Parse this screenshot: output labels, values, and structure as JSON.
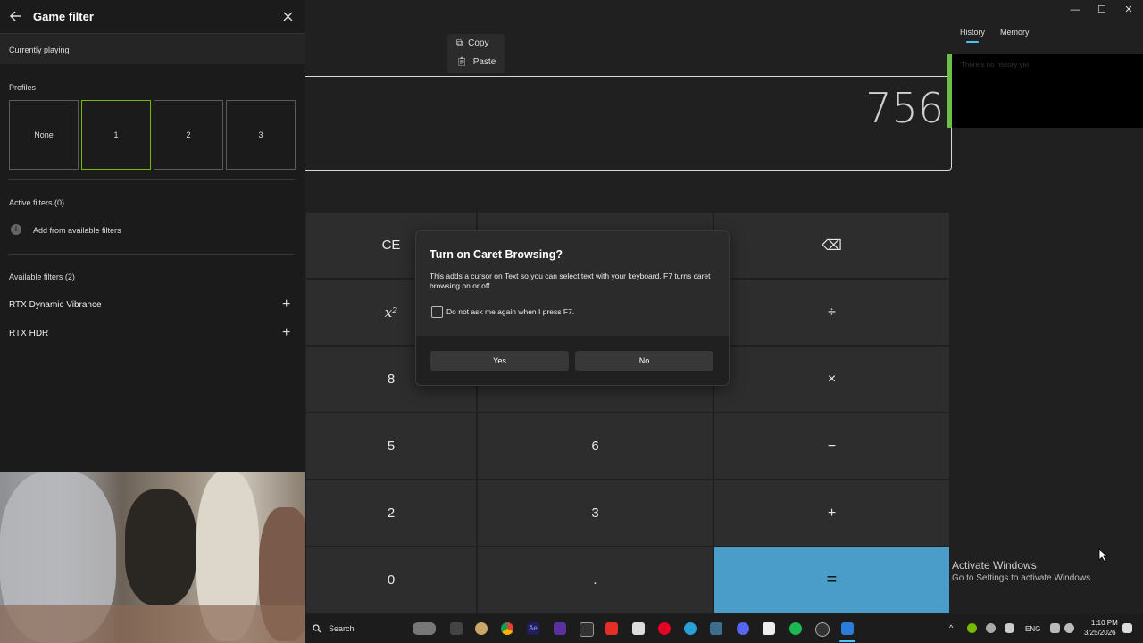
{
  "calculator": {
    "window_controls": [
      "—",
      "☐",
      "✕"
    ],
    "context_menu": {
      "copy": "Copy",
      "paste": "Paste"
    },
    "display_value": "756",
    "history_tabs": {
      "history": "History",
      "memory": "Memory"
    },
    "history_empty": "There's no history yet",
    "keys": {
      "ce": "CE",
      "backspace": "⌫",
      "x2": "x²",
      "divide": "÷",
      "multiply": "×",
      "eight": "8",
      "five": "5",
      "six": "6",
      "minus": "−",
      "two": "2",
      "three": "3",
      "plus": "+",
      "zero": "0",
      "decimal": ".",
      "equals": "="
    },
    "activate_title": "Activate Windows",
    "activate_sub": "Go to Settings to activate Windows."
  },
  "dialog": {
    "title": "Turn on Caret Browsing?",
    "body": "This adds a cursor on Text so you can select text with your keyboard. F7 turns caret browsing on or off.",
    "checkbox_label": "Do not ask me again when I press F7.",
    "yes": "Yes",
    "no": "No"
  },
  "game_filter": {
    "title": "Game filter",
    "currently_playing": "Currently playing",
    "profiles_label": "Profiles",
    "profiles": [
      "None",
      "1",
      "2",
      "3"
    ],
    "active_filters": "Active filters (0)",
    "add_from_available": "Add from available filters",
    "available_filters": "Available filters (2)",
    "filters": [
      "RTX Dynamic Vibrance",
      "RTX HDR"
    ]
  },
  "taskbar": {
    "search": "Search",
    "lang": "ENG",
    "time": "1:10 PM",
    "date": "3/25/2026"
  },
  "colors": {
    "accent_green": "#76b900",
    "equals_blue": "#4a9cc9",
    "tab_underline": "#4cc2ff"
  }
}
